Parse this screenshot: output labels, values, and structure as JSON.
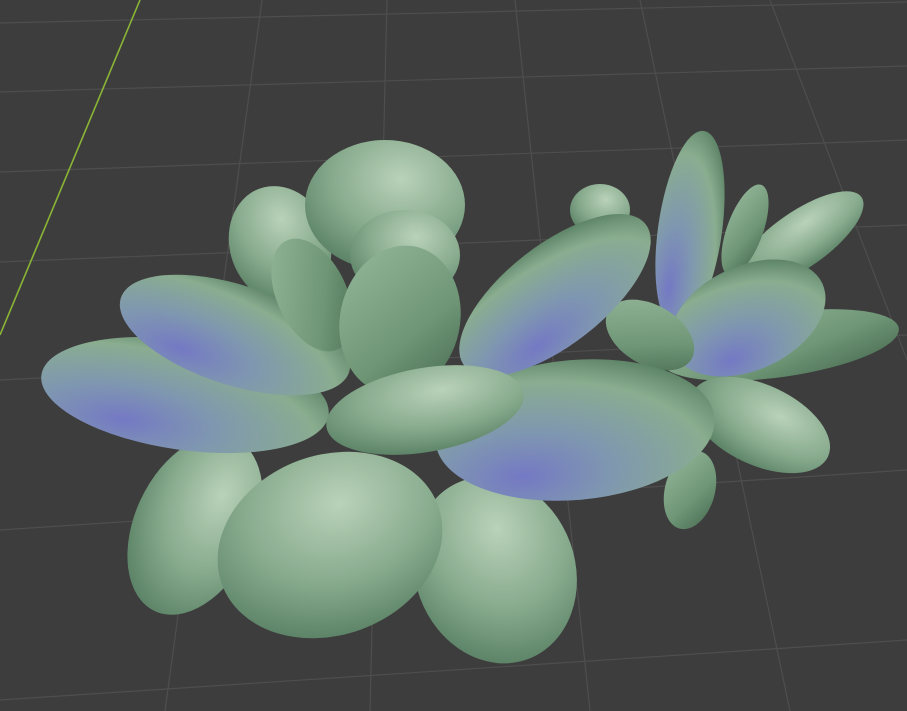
{
  "viewport": {
    "background_color": "#3d3d3d",
    "grid_line_color": "#4e4e4e",
    "axis_y_color": "#8ab535",
    "objects": [
      {
        "kind": "succulent-rosette",
        "leaf_color": "#86a98c",
        "leaf_highlight": "#b3cdb4",
        "leaf_shadow": "#4d7458",
        "inner_tint": "#7b80c7"
      },
      {
        "kind": "succulent-rosette",
        "leaf_color": "#86a98c",
        "leaf_highlight": "#b3cdb4",
        "leaf_shadow": "#4d7458",
        "inner_tint": "#7b80c7"
      }
    ]
  }
}
